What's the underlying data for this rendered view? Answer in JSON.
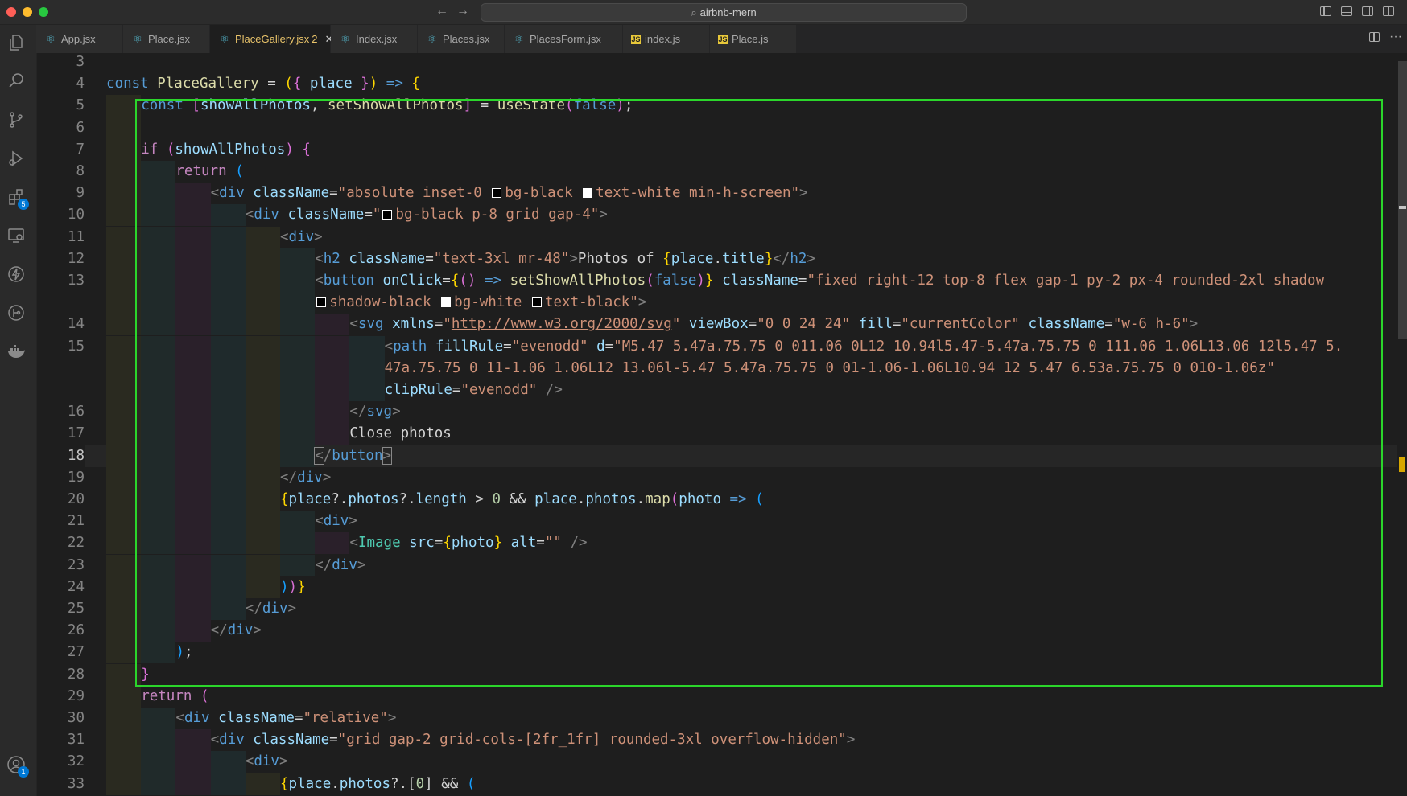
{
  "window": {
    "search_text": "airbnb-mern"
  },
  "activity_bar": {
    "extensions_badge": "5",
    "accounts_badge": "1"
  },
  "tabs": [
    {
      "label": "App.jsx",
      "icon": "react-icon",
      "active": false
    },
    {
      "label": "Place.jsx",
      "icon": "react-icon",
      "active": false
    },
    {
      "label": "PlaceGallery.jsx",
      "icon": "react-icon",
      "active": true,
      "problems": "2"
    },
    {
      "label": "Index.jsx",
      "icon": "react-icon",
      "active": false
    },
    {
      "label": "Places.jsx",
      "icon": "react-icon",
      "active": false
    },
    {
      "label": "PlacesForm.jsx",
      "icon": "react-icon",
      "active": false
    },
    {
      "label": "index.js",
      "icon": "js-icon",
      "active": false
    },
    {
      "label": "Place.js",
      "icon": "js-icon",
      "active": false
    }
  ],
  "editor": {
    "current_line": 18,
    "lines": [
      {
        "n": "3",
        "indent": 0,
        "tokens": []
      },
      {
        "n": "4",
        "indent": 0,
        "tokens": [
          [
            "k",
            "const"
          ],
          [
            "t",
            " "
          ],
          [
            "fn",
            "PlaceGallery"
          ],
          [
            "t",
            " = "
          ],
          [
            "b1",
            "("
          ],
          [
            "b2",
            "{"
          ],
          [
            "t",
            " "
          ],
          [
            "v",
            "place"
          ],
          [
            "t",
            " "
          ],
          [
            "b2",
            "}"
          ],
          [
            "b1",
            ")"
          ],
          [
            "t",
            " "
          ],
          [
            "k",
            "=>"
          ],
          [
            "t",
            " "
          ],
          [
            "b1",
            "{"
          ]
        ]
      },
      {
        "n": "5",
        "indent": 1,
        "tokens": [
          [
            "k",
            "const"
          ],
          [
            "t",
            " "
          ],
          [
            "b2",
            "["
          ],
          [
            "v",
            "showAllPhotos"
          ],
          [
            "t",
            ", "
          ],
          [
            "fn",
            "setShowAllPhotos"
          ],
          [
            "b2",
            "]"
          ],
          [
            "t",
            " = "
          ],
          [
            "fn",
            "useState"
          ],
          [
            "b2",
            "("
          ],
          [
            "k",
            "false"
          ],
          [
            "b2",
            ")"
          ],
          [
            "t",
            ";"
          ]
        ]
      },
      {
        "n": "6",
        "indent": 1,
        "tokens": []
      },
      {
        "n": "7",
        "indent": 1,
        "tokens": [
          [
            "ctl",
            "if"
          ],
          [
            "t",
            " "
          ],
          [
            "b2",
            "("
          ],
          [
            "v",
            "showAllPhotos"
          ],
          [
            "b2",
            ")"
          ],
          [
            "t",
            " "
          ],
          [
            "b2",
            "{"
          ]
        ]
      },
      {
        "n": "8",
        "indent": 2,
        "tokens": [
          [
            "ctl",
            "return"
          ],
          [
            "t",
            " "
          ],
          [
            "b3",
            "("
          ]
        ]
      },
      {
        "n": "9",
        "indent": 3,
        "tokens": [
          [
            "pu",
            "<"
          ],
          [
            "tg",
            "div"
          ],
          [
            "t",
            " "
          ],
          [
            "v",
            "className"
          ],
          [
            "t",
            "="
          ],
          [
            "s",
            "\"absolute inset-0 "
          ],
          [
            "swb",
            ""
          ],
          [
            "s",
            "bg-black "
          ],
          [
            "sww",
            ""
          ],
          [
            "s",
            "text-white min-h-screen\""
          ],
          [
            "pu",
            ">"
          ]
        ]
      },
      {
        "n": "10",
        "indent": 4,
        "tokens": [
          [
            "pu",
            "<"
          ],
          [
            "tg",
            "div"
          ],
          [
            "t",
            " "
          ],
          [
            "v",
            "className"
          ],
          [
            "t",
            "="
          ],
          [
            "s",
            "\""
          ],
          [
            "swb",
            ""
          ],
          [
            "s",
            "bg-black p-8 grid gap-4\""
          ],
          [
            "pu",
            ">"
          ]
        ]
      },
      {
        "n": "11",
        "indent": 5,
        "tokens": [
          [
            "pu",
            "<"
          ],
          [
            "tg",
            "div"
          ],
          [
            "pu",
            ">"
          ]
        ]
      },
      {
        "n": "12",
        "indent": 6,
        "tokens": [
          [
            "pu",
            "<"
          ],
          [
            "tg",
            "h2"
          ],
          [
            "t",
            " "
          ],
          [
            "v",
            "className"
          ],
          [
            "t",
            "="
          ],
          [
            "s",
            "\"text-3xl mr-48\""
          ],
          [
            "pu",
            ">"
          ],
          [
            "t",
            "Photos of "
          ],
          [
            "b1",
            "{"
          ],
          [
            "v",
            "place"
          ],
          [
            "t",
            "."
          ],
          [
            "v",
            "title"
          ],
          [
            "b1",
            "}"
          ],
          [
            "pu",
            "</"
          ],
          [
            "tg",
            "h2"
          ],
          [
            "pu",
            ">"
          ]
        ]
      },
      {
        "n": "13",
        "indent": 6,
        "tokens": [
          [
            "pu",
            "<"
          ],
          [
            "tg",
            "button"
          ],
          [
            "t",
            " "
          ],
          [
            "v",
            "onClick"
          ],
          [
            "t",
            "="
          ],
          [
            "b1",
            "{"
          ],
          [
            "b2",
            "()"
          ],
          [
            "t",
            " "
          ],
          [
            "k",
            "=>"
          ],
          [
            "t",
            " "
          ],
          [
            "fn",
            "setShowAllPhotos"
          ],
          [
            "b2",
            "("
          ],
          [
            "k",
            "false"
          ],
          [
            "b2",
            ")"
          ],
          [
            "b1",
            "}"
          ],
          [
            "t",
            " "
          ],
          [
            "v",
            "className"
          ],
          [
            "t",
            "="
          ],
          [
            "s",
            "\"fixed right-12 top-8 flex gap-1 py-2 px-4 rounded-2xl shadow"
          ]
        ]
      },
      {
        "n": "",
        "indent": 6,
        "tokens": [
          [
            "swb",
            ""
          ],
          [
            "s",
            "shadow-black "
          ],
          [
            "sww",
            ""
          ],
          [
            "s",
            "bg-white "
          ],
          [
            "swb",
            ""
          ],
          [
            "s",
            "text-black\""
          ],
          [
            "pu",
            ">"
          ]
        ]
      },
      {
        "n": "14",
        "indent": 7,
        "tokens": [
          [
            "pu",
            "<"
          ],
          [
            "tg",
            "svg"
          ],
          [
            "t",
            " "
          ],
          [
            "v",
            "xmlns"
          ],
          [
            "t",
            "="
          ],
          [
            "s",
            "\""
          ],
          [
            "su",
            "http://www.w3.org/2000/svg"
          ],
          [
            "s",
            "\""
          ],
          [
            "t",
            " "
          ],
          [
            "v",
            "viewBox"
          ],
          [
            "t",
            "="
          ],
          [
            "s",
            "\"0 0 24 24\""
          ],
          [
            "t",
            " "
          ],
          [
            "v",
            "fill"
          ],
          [
            "t",
            "="
          ],
          [
            "s",
            "\"currentColor\""
          ],
          [
            "t",
            " "
          ],
          [
            "v",
            "className"
          ],
          [
            "t",
            "="
          ],
          [
            "s",
            "\"w-6 h-6\""
          ],
          [
            "pu",
            ">"
          ]
        ]
      },
      {
        "n": "15",
        "indent": 8,
        "tokens": [
          [
            "pu",
            "<"
          ],
          [
            "tg",
            "path"
          ],
          [
            "t",
            " "
          ],
          [
            "v",
            "fillRule"
          ],
          [
            "t",
            "="
          ],
          [
            "s",
            "\"evenodd\""
          ],
          [
            "t",
            " "
          ],
          [
            "v",
            "d"
          ],
          [
            "t",
            "="
          ],
          [
            "s",
            "\"M5.47 5.47a.75.75 0 011.06 0L12 10.94l5.47-5.47a.75.75 0 111.06 1.06L13.06 12l5.47 5."
          ]
        ]
      },
      {
        "n": "",
        "indent": 8,
        "tokens": [
          [
            "s",
            "47a.75.75 0 11-1.06 1.06L12 13.06l-5.47 5.47a.75.75 0 01-1.06-1.06L10.94 12 5.47 6.53a.75.75 0 010-1.06z\""
          ]
        ]
      },
      {
        "n": "",
        "indent": 8,
        "tokens": [
          [
            "v",
            "clipRule"
          ],
          [
            "t",
            "="
          ],
          [
            "s",
            "\"evenodd\""
          ],
          [
            "t",
            " "
          ],
          [
            "pu",
            "/>"
          ]
        ]
      },
      {
        "n": "16",
        "indent": 7,
        "tokens": [
          [
            "pu",
            "</"
          ],
          [
            "tg",
            "svg"
          ],
          [
            "pu",
            ">"
          ]
        ]
      },
      {
        "n": "17",
        "indent": 7,
        "tokens": [
          [
            "t",
            "Close photos"
          ]
        ]
      },
      {
        "n": "18",
        "indent": 6,
        "tokens": [
          [
            "pum",
            "<"
          ],
          [
            "pu",
            "/"
          ],
          [
            "tg",
            "button"
          ],
          [
            "pum",
            ">"
          ]
        ]
      },
      {
        "n": "19",
        "indent": 5,
        "tokens": [
          [
            "pu",
            "</"
          ],
          [
            "tg",
            "div"
          ],
          [
            "pu",
            ">"
          ]
        ]
      },
      {
        "n": "20",
        "indent": 5,
        "tokens": [
          [
            "b1",
            "{"
          ],
          [
            "v",
            "place"
          ],
          [
            "t",
            "?."
          ],
          [
            "v",
            "photos"
          ],
          [
            "t",
            "?."
          ],
          [
            "v",
            "length"
          ],
          [
            "t",
            " > "
          ],
          [
            "n",
            "0"
          ],
          [
            "t",
            " && "
          ],
          [
            "v",
            "place"
          ],
          [
            "t",
            "."
          ],
          [
            "v",
            "photos"
          ],
          [
            "t",
            "."
          ],
          [
            "fn",
            "map"
          ],
          [
            "b2",
            "("
          ],
          [
            "v",
            "photo"
          ],
          [
            "t",
            " "
          ],
          [
            "k",
            "=>"
          ],
          [
            "t",
            " "
          ],
          [
            "b3",
            "("
          ]
        ]
      },
      {
        "n": "21",
        "indent": 6,
        "tokens": [
          [
            "pu",
            "<"
          ],
          [
            "tg",
            "div"
          ],
          [
            "pu",
            ">"
          ]
        ]
      },
      {
        "n": "22",
        "indent": 7,
        "tokens": [
          [
            "pu",
            "<"
          ],
          [
            "cm",
            "Image"
          ],
          [
            "t",
            " "
          ],
          [
            "v",
            "src"
          ],
          [
            "t",
            "="
          ],
          [
            "b1",
            "{"
          ],
          [
            "v",
            "photo"
          ],
          [
            "b1",
            "}"
          ],
          [
            "t",
            " "
          ],
          [
            "v",
            "alt"
          ],
          [
            "t",
            "="
          ],
          [
            "s",
            "\"\""
          ],
          [
            "t",
            " "
          ],
          [
            "pu",
            "/>"
          ]
        ]
      },
      {
        "n": "23",
        "indent": 6,
        "tokens": [
          [
            "pu",
            "</"
          ],
          [
            "tg",
            "div"
          ],
          [
            "pu",
            ">"
          ]
        ]
      },
      {
        "n": "24",
        "indent": 5,
        "tokens": [
          [
            "b3",
            ")"
          ],
          [
            "b2",
            ")"
          ],
          [
            "b1",
            "}"
          ]
        ]
      },
      {
        "n": "25",
        "indent": 4,
        "tokens": [
          [
            "pu",
            "</"
          ],
          [
            "tg",
            "div"
          ],
          [
            "pu",
            ">"
          ]
        ]
      },
      {
        "n": "26",
        "indent": 3,
        "tokens": [
          [
            "pu",
            "</"
          ],
          [
            "tg",
            "div"
          ],
          [
            "pu",
            ">"
          ]
        ]
      },
      {
        "n": "27",
        "indent": 2,
        "tokens": [
          [
            "b3",
            ")"
          ],
          [
            "t",
            ";"
          ]
        ]
      },
      {
        "n": "28",
        "indent": 1,
        "tokens": [
          [
            "b2",
            "}"
          ]
        ]
      },
      {
        "n": "29",
        "indent": 1,
        "tokens": [
          [
            "ctl",
            "return"
          ],
          [
            "t",
            " "
          ],
          [
            "b2",
            "("
          ]
        ]
      },
      {
        "n": "30",
        "indent": 2,
        "tokens": [
          [
            "pu",
            "<"
          ],
          [
            "tg",
            "div"
          ],
          [
            "t",
            " "
          ],
          [
            "v",
            "className"
          ],
          [
            "t",
            "="
          ],
          [
            "s",
            "\"relative\""
          ],
          [
            "pu",
            ">"
          ]
        ]
      },
      {
        "n": "31",
        "indent": 3,
        "tokens": [
          [
            "pu",
            "<"
          ],
          [
            "tg",
            "div"
          ],
          [
            "t",
            " "
          ],
          [
            "v",
            "className"
          ],
          [
            "t",
            "="
          ],
          [
            "s",
            "\"grid gap-2 grid-cols-[2fr_1fr] rounded-3xl overflow-hidden\""
          ],
          [
            "pu",
            ">"
          ]
        ]
      },
      {
        "n": "32",
        "indent": 4,
        "tokens": [
          [
            "pu",
            "<"
          ],
          [
            "tg",
            "div"
          ],
          [
            "pu",
            ">"
          ]
        ]
      },
      {
        "n": "33",
        "indent": 5,
        "tokens": [
          [
            "b1",
            "{"
          ],
          [
            "v",
            "place"
          ],
          [
            "t",
            "."
          ],
          [
            "v",
            "photos"
          ],
          [
            "t",
            "?.["
          ],
          [
            "n",
            "0"
          ],
          [
            "t",
            "] && "
          ],
          [
            "b3",
            "("
          ]
        ]
      }
    ]
  },
  "colors": {
    "highlight_frame": "#2bd62b",
    "indent_guides": [
      "#2a2a20",
      "#202a2a",
      "#2a202a",
      "#1f2a2c"
    ],
    "active_tab_text": "#e8c36a"
  }
}
